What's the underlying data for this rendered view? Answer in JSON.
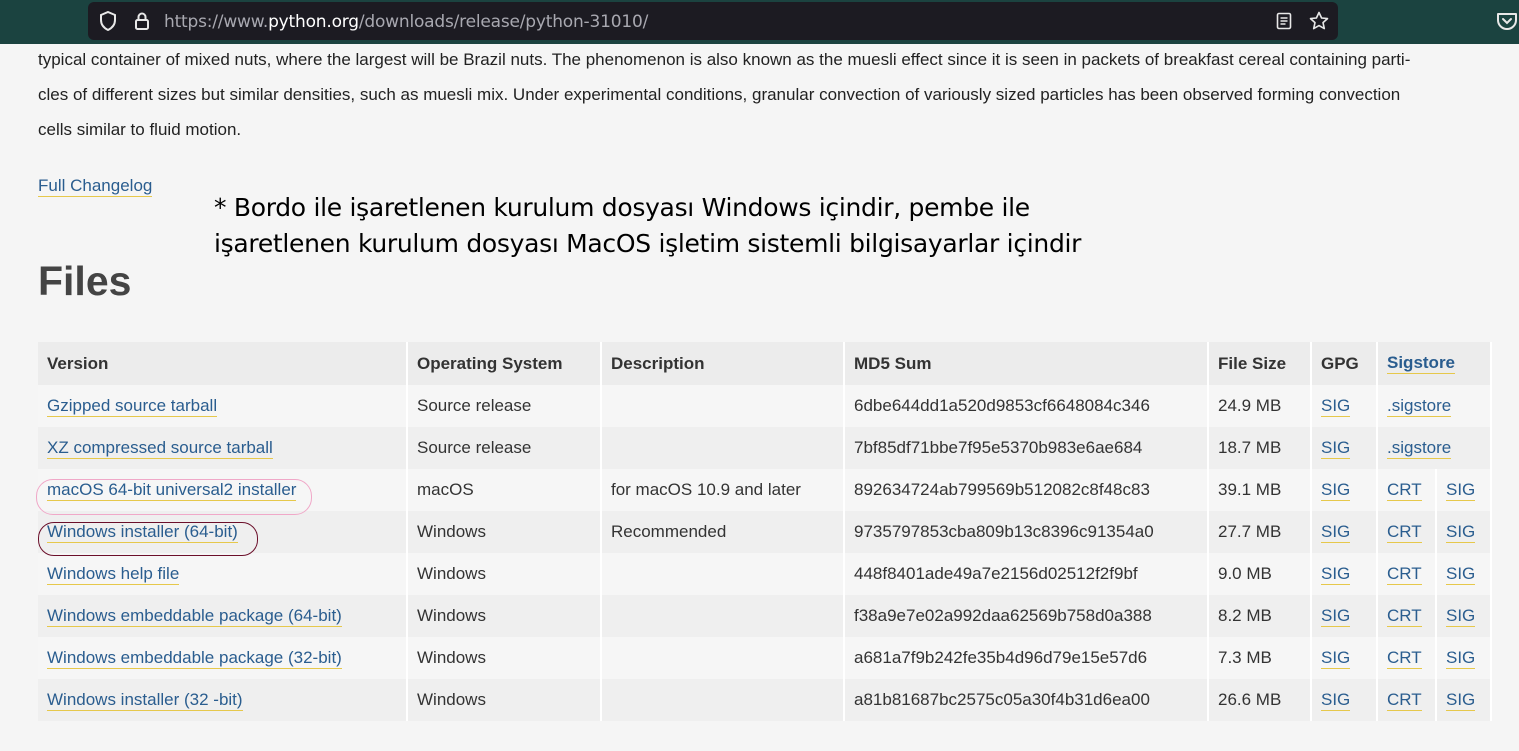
{
  "browser": {
    "url_prefix": "https://www.",
    "url_host": "python.org",
    "url_path": "/downloads/release/python-31010/",
    "icons": [
      "shield-icon",
      "lock-icon",
      "reader-view-icon",
      "bookmark-star-icon",
      "pocket-icon"
    ]
  },
  "page": {
    "paragraph": "typical container of mixed nuts, where the largest will be Brazil nuts. The phenomenon is also known as the muesli effect since it is seen in packets of breakfast cereal containing parti-cles of different sizes but similar densities, such as muesli mix. Under experimental conditions, granular convection of variously sized particles has been observed forming convection cells similar to fluid motion.",
    "para_line1": "typical container of mixed nuts, where the largest will be Brazil nuts. The phenomenon is also known as the muesli effect since it is seen in packets of breakfast cereal containing parti-",
    "para_line2": "cles of different sizes but similar densities, such as muesli mix. Under experimental conditions, granular convection of variously sized particles has been observed forming convection",
    "para_line3": "cells similar to fluid motion.",
    "changelog": "Full Changelog",
    "note_line1": "* Bordo ile işaretlenen kurulum dosyası Windows içindir, pembe ile",
    "note_line2": "işaretlenen kurulum dosyası MacOS işletim sistemli bilgisayarlar içindir",
    "files_heading": "Files"
  },
  "table": {
    "headers": [
      "Version",
      "Operating System",
      "Description",
      "MD5 Sum",
      "File Size",
      "GPG",
      "Sigstore"
    ],
    "rows": [
      {
        "version": "Gzipped source tarball",
        "os": "Source release",
        "desc": "",
        "md5": "6dbe644dd1a520d9853cf6648084c346",
        "size": "24.9 MB",
        "gpg": "SIG",
        "s1": ".sigstore",
        "s2": ""
      },
      {
        "version": "XZ compressed source tarball",
        "os": "Source release",
        "desc": "",
        "md5": "7bf85df71bbe7f95e5370b983e6ae684",
        "size": "18.7 MB",
        "gpg": "SIG",
        "s1": ".sigstore",
        "s2": ""
      },
      {
        "version": "macOS 64-bit universal2 installer",
        "os": "macOS",
        "desc": "for macOS 10.9 and later",
        "md5": "892634724ab799569b512082c8f48c83",
        "size": "39.1 MB",
        "gpg": "SIG",
        "s1": "CRT",
        "s2": "SIG"
      },
      {
        "version": "Windows installer (64-bit)",
        "os": "Windows",
        "desc": "Recommended",
        "md5": "9735797853cba809b13c8396c91354a0",
        "size": "27.7 MB",
        "gpg": "SIG",
        "s1": "CRT",
        "s2": "SIG"
      },
      {
        "version": "Windows help file",
        "os": "Windows",
        "desc": "",
        "md5": "448f8401ade49a7e2156d02512f2f9bf",
        "size": "9.0 MB",
        "gpg": "SIG",
        "s1": "CRT",
        "s2": "SIG"
      },
      {
        "version": "Windows embeddable package (64-bit)",
        "os": "Windows",
        "desc": "",
        "md5": "f38a9e7e02a992daa62569b758d0a388",
        "size": "8.2 MB",
        "gpg": "SIG",
        "s1": "CRT",
        "s2": "SIG"
      },
      {
        "version": "Windows embeddable package (32-bit)",
        "os": "Windows",
        "desc": "",
        "md5": "a681a7f9b242fe35b4d96d79e15e57d6",
        "size": "7.3 MB",
        "gpg": "SIG",
        "s1": "CRT",
        "s2": "SIG"
      },
      {
        "version": "Windows installer (32 -bit)",
        "os": "Windows",
        "desc": "",
        "md5": "a81b81687bc2575c05a30f4b31d6ea00",
        "size": "26.6 MB",
        "gpg": "SIG",
        "s1": "CRT",
        "s2": "SIG"
      }
    ]
  },
  "colors": {
    "link": "#2a5d8f",
    "link_underline": "#e6c84b",
    "mark_pink": "#f0a8c8",
    "mark_bordo": "#6b0f2a",
    "toolbar": "#1b4340"
  }
}
